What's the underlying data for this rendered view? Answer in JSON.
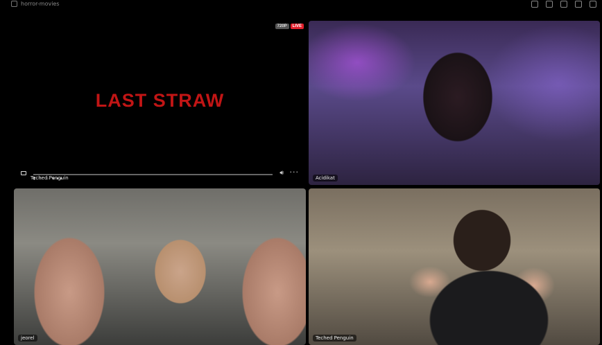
{
  "topbar": {
    "channel": "horror-movies"
  },
  "stream": {
    "title_art": "LAST STRAW",
    "resolution": "720P",
    "live": "LIVE",
    "streamer": "Teched Penguin"
  },
  "participants": [
    {
      "name": "Acidikat"
    },
    {
      "name": "jeorel"
    },
    {
      "name": "Teched Penguin"
    }
  ],
  "colors": {
    "accent": "#c11515",
    "live": "#e0202c"
  }
}
